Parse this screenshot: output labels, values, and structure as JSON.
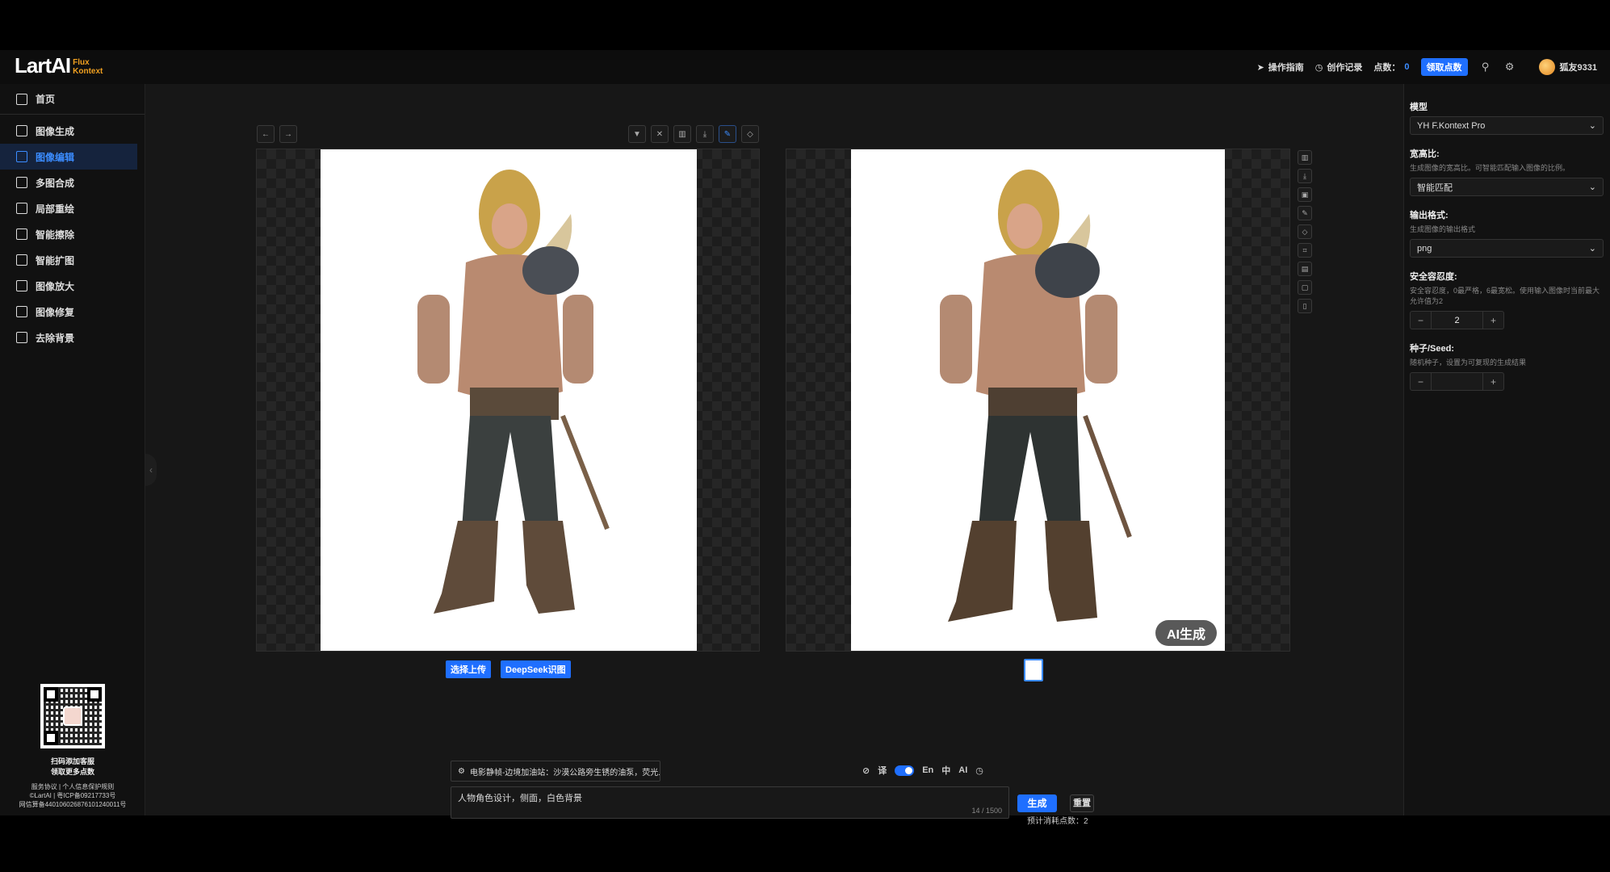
{
  "brand": {
    "name": "LartAI",
    "sub1": "Flux",
    "sub2": "Kontext"
  },
  "header": {
    "guide": "操作指南",
    "history": "创作记录",
    "points_label": "点数：",
    "points_value": "0",
    "claim_button": "领取点数",
    "username": "狐友9331"
  },
  "sidebar": {
    "items": [
      {
        "label": "首页",
        "icon": "home-icon"
      },
      {
        "label": "图像生成",
        "icon": "chat-image-icon"
      },
      {
        "label": "图像编辑",
        "icon": "image-edit-icon"
      },
      {
        "label": "多图合成",
        "icon": "multi-image-icon"
      },
      {
        "label": "局部重绘",
        "icon": "pencil-edit-icon"
      },
      {
        "label": "智能擦除",
        "icon": "eraser-icon"
      },
      {
        "label": "智能扩图",
        "icon": "crop-icon"
      },
      {
        "label": "图像放大",
        "icon": "upscale-icon"
      },
      {
        "label": "图像修复",
        "icon": "repair-icon"
      },
      {
        "label": "去除背景",
        "icon": "remove-bg-icon"
      }
    ],
    "active_index": 2,
    "footer": {
      "qr_line1": "扫码添加客服",
      "qr_line2": "领取更多点数",
      "links": "服务协议 | 个人信息保护规则",
      "icp": "©LartAI | 粤ICP备09217733号",
      "police": "网信算备440106026876101240011号"
    }
  },
  "editor": {
    "ai_badge": "AI生成",
    "upload_button": "选择上传",
    "deepseek_button": "DeepSeek识图"
  },
  "prompt": {
    "preset": "电影静帧-边境加油站：沙漠公路旁生锈的油泵，荧光...",
    "translate_label": "译",
    "lang_en": "En",
    "lang_zh": "中",
    "ai_label": "AI",
    "text": "人物角色设计，侧面，白色背景",
    "counter": "14 / 1500",
    "generate_button": "生成",
    "reset_button": "重置",
    "estimate": "预计消耗点数：2"
  },
  "settings": {
    "model_label": "模型",
    "model_value": "YH F.Kontext Pro",
    "ratio_label": "宽高比:",
    "ratio_desc": "生成图像的宽高比。可智能匹配输入图像的比例。",
    "ratio_value": "智能匹配",
    "format_label": "输出格式:",
    "format_desc": "生成图像的输出格式",
    "format_value": "png",
    "safety_label": "安全容忍度:",
    "safety_desc": "安全容忍度，0最严格，6最宽松。使用输入图像时当前最大允许值为2",
    "safety_value": "2",
    "seed_label": "种子/Seed:",
    "seed_desc": "随机种子，设置为可复现的生成结果",
    "seed_value": ""
  }
}
